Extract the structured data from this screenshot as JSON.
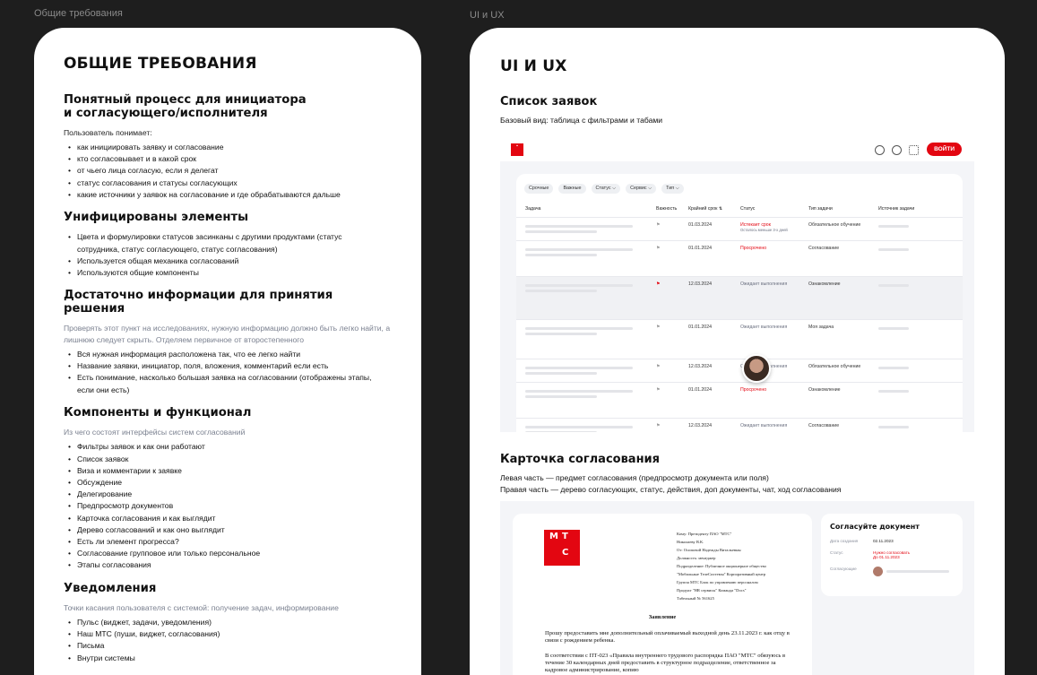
{
  "frame_labels": {
    "left": "Общие требования",
    "right": "UI и UX"
  },
  "left": {
    "title": "ОБЩИЕ ТРЕБОВАНИЯ",
    "sections": [
      {
        "title": "Понятный процесс для инициатора и согласующего/исполнителя",
        "intro": "Пользователь понимает:",
        "items": [
          "как инициировать заявку и согласование",
          "кто согласовывает и в какой срок",
          "от чьего лица согласую, если я делегат",
          "статус согласования и статусы согласующих",
          "какие источники у заявок на согласование и где обрабатываются дальше"
        ]
      },
      {
        "title": "Унифицированы элементы",
        "items": [
          "Цвета и формулировки статусов засинканы с другими продуктами (статус сотрудника, статус согласующего, статус согласования)",
          "Используется общая механика согласований",
          "Используются общие компоненты"
        ]
      },
      {
        "title": "Достаточно информации для принятия решения",
        "intro": "Проверять этот пункт на исследованиях, нужную информацию должно быть легко найти, а лишнюю следует скрыть. Отделяем первичное от второстепенного",
        "items": [
          "Вся нужная информация расположена так, что ее легко найти",
          "Название заявки, инициатор, поля, вложения, комментарий если есть",
          "Есть понимание, насколько большая заявка на согласовании (отображены этапы, если они есть)"
        ]
      },
      {
        "title": "Компоненты и функционал",
        "intro": "Из чего состоят интерфейсы систем согласований",
        "items": [
          "Фильтры заявок и как они работают",
          "Список заявок",
          "Виза и комментарии к заявке",
          "Обсуждение",
          "Делегирование",
          "Предпросмотр документов",
          "Карточка согласования и как выглядит",
          "Дерево согласований и как оно выглядит",
          "Есть ли элемент прогресса?",
          "Согласование групповое или только персональное",
          "Этапы согласования"
        ]
      },
      {
        "title": "Уведомления",
        "intro": "Точки касания пользователя с системой: получение задач, информирование",
        "items": [
          "Пульс  (виджет, задачи, уведомления)",
          "Наш МТС (пуши, виджет, согласования)",
          "Письма",
          "Внутри системы"
        ]
      }
    ]
  },
  "right": {
    "title": "UI И UX",
    "list": {
      "title": "Список заявок",
      "desc": "Базовый вид: таблица с фильтрами и табами",
      "login": "ВОЙТИ",
      "chips": [
        "Срочные",
        "Важные",
        "Статус ⌵",
        "Сервис ⌵",
        "Тип ⌵"
      ],
      "columns": [
        "Задача",
        "Важность",
        "Крайний срок ⇅",
        "Статус",
        "Тип задачи",
        "Источник задачи"
      ],
      "rows": [
        {
          "date": "01.03.2024",
          "status": "Истекает срок",
          "status_note": "Осталось меньше 3-х дней",
          "kind": "red",
          "type": "Обязательное обучение"
        },
        {
          "date": "01.01.2024",
          "status": "Просрочено",
          "kind": "red",
          "type": "Согласование"
        },
        {
          "date": "12.03.2024",
          "status": "Ожидает выполнения",
          "kind": "gray",
          "type": "Ознакомление",
          "highlight": true,
          "flag_red": true
        },
        {
          "date": "01.01.2024",
          "status": "Ожидает выполнения",
          "kind": "gray",
          "type": "Моя задача"
        },
        {
          "date": "12.03.2024",
          "status": "Ожидает выполнения",
          "kind": "gray",
          "type": "Обязательное обучение"
        },
        {
          "date": "01.01.2024",
          "status": "Просрочено",
          "kind": "red",
          "type": "Ознакомление"
        },
        {
          "date": "12.03.2024",
          "status": "Ожидает выполнения",
          "kind": "gray",
          "type": "Согласование"
        }
      ]
    },
    "card": {
      "title": "Карточка согласования",
      "desc_1": "Левая часть — предмет согласования (предпросмотр документа или поля)",
      "desc_2": "Правая часть — дерево согласующих, статус, действия, доп документы, чат, ход согласования",
      "logo": [
        "М",
        "Т",
        "",
        "С"
      ],
      "addr_lines": [
        "Кому: Президенту ПАО \"МТС\"",
        "Николаеву В.К.",
        "От: Осиповой Надежды Витальевны",
        "Должность: менеджер",
        "Подразделение: Публичное акционерное общество",
        "\"Мобильные ТелеСистемы\" Корпоративный центр",
        "Группа МТС Блок по управлению персоналом",
        "Продукт \"HR сервисы\" Команда \"Docs\"",
        "Табельный № 561625"
      ],
      "doc_title": "Заявление",
      "doc_p1": "Прошу предоставить мне дополнительный оплачиваемый выходной день 23.11.2023 г. как отцу в связи с рождением ребенка.",
      "doc_p2": "В соответствии с ПТ-023 «Правила внутреннего трудового распорядка ПАО \"МТС\" обязуюсь в течение 30 календарных дней  предоставить в структурное подразделение, ответственное за кадровое администрирование, копию",
      "side_title": "Согласуйте документ",
      "date_label": "Дата создания",
      "date_value": "02.11.2023",
      "status_label": "Статус",
      "status_value": "Нужно согласовать",
      "status_due": "До 01.11.2023",
      "approver_label": "Согласующие"
    }
  }
}
